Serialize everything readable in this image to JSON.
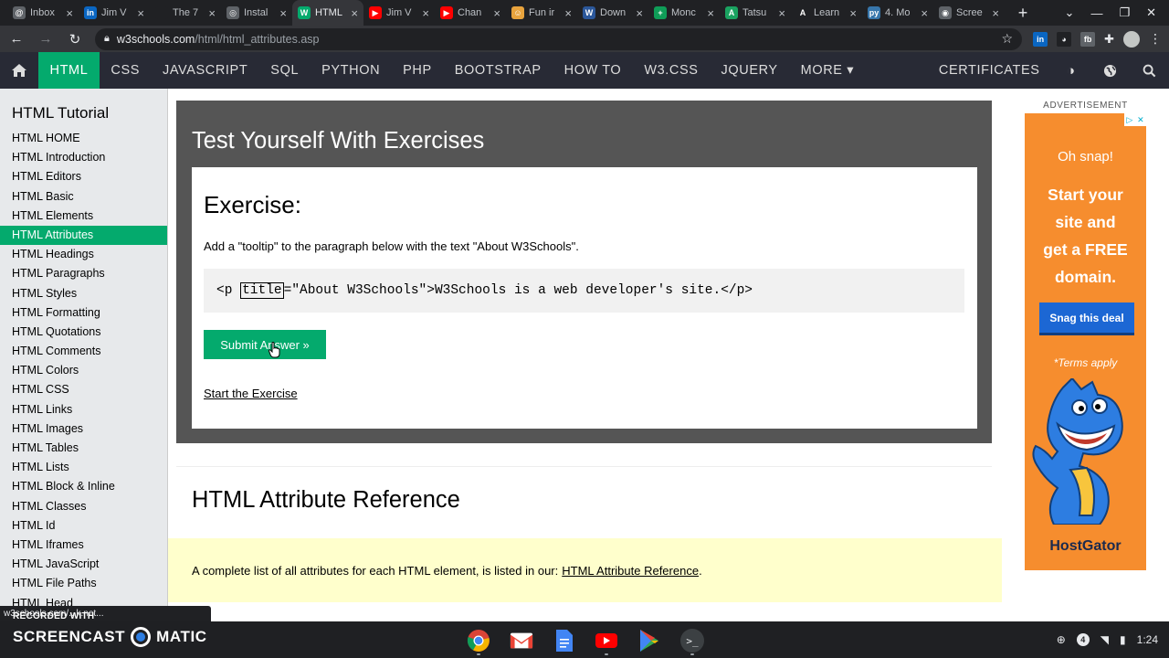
{
  "browser": {
    "tabs": [
      {
        "label": "Inbox",
        "fav_color": "#5f6368",
        "fav_text": "@",
        "active": false
      },
      {
        "label": "Jim V",
        "fav_color": "#0a66c2",
        "fav_text": "in",
        "active": false
      },
      {
        "label": "The 7",
        "fav_color": "#202124",
        "fav_text": "",
        "active": false
      },
      {
        "label": "Instal",
        "fav_color": "#5f6368",
        "fav_text": "◎",
        "active": false
      },
      {
        "label": "HTML",
        "fav_color": "#04AA6D",
        "fav_text": "W",
        "active": true
      },
      {
        "label": "Jim V",
        "fav_color": "#ff0000",
        "fav_text": "▶",
        "active": false
      },
      {
        "label": "Chan",
        "fav_color": "#ff0000",
        "fav_text": "▶",
        "active": false
      },
      {
        "label": "Fun ir",
        "fav_color": "#e8a33d",
        "fav_text": "☺",
        "active": false
      },
      {
        "label": "Down",
        "fav_color": "#2b579a",
        "fav_text": "W",
        "active": false
      },
      {
        "label": "Monc",
        "fav_color": "#0f9d58",
        "fav_text": "+",
        "active": false
      },
      {
        "label": "Tatsu",
        "fav_color": "#1aa260",
        "fav_text": "A",
        "active": false
      },
      {
        "label": "Learn",
        "fav_color": "#202124",
        "fav_text": "A",
        "active": false
      },
      {
        "label": "4. Mo",
        "fav_color": "#3776ab",
        "fav_text": "py",
        "active": false
      },
      {
        "label": "Scree",
        "fav_color": "#5f6368",
        "fav_text": "◉",
        "active": false
      }
    ],
    "url_host": "w3schools.com",
    "url_path": "/html/html_attributes.asp"
  },
  "w3nav": {
    "items": [
      "HTML",
      "CSS",
      "JAVASCRIPT",
      "SQL",
      "PYTHON",
      "PHP",
      "BOOTSTRAP",
      "HOW TO",
      "W3.CSS",
      "JQUERY",
      "MORE ▾"
    ],
    "certificates": "CERTIFICATES"
  },
  "sidebar": {
    "title": "HTML Tutorial",
    "items": [
      "HTML HOME",
      "HTML Introduction",
      "HTML Editors",
      "HTML Basic",
      "HTML Elements",
      "HTML Attributes",
      "HTML Headings",
      "HTML Paragraphs",
      "HTML Styles",
      "HTML Formatting",
      "HTML Quotations",
      "HTML Comments",
      "HTML Colors",
      "HTML CSS",
      "HTML Links",
      "HTML Images",
      "HTML Tables",
      "HTML Lists",
      "HTML Block & Inline",
      "HTML Classes",
      "HTML Id",
      "HTML Iframes",
      "HTML JavaScript",
      "HTML File Paths",
      "HTML Head"
    ],
    "active_index": 5
  },
  "exercise": {
    "heading": "Test Yourself With Exercises",
    "title": "Exercise:",
    "instruction": "Add a \"tooltip\" to the paragraph below with the text \"About W3Schools\".",
    "code_before": "<p ",
    "code_blank": "title",
    "code_after": "=\"About W3Schools\">W3Schools is a web developer's site.</p>",
    "submit_label": "Submit Answer »",
    "start_label": "Start the Exercise"
  },
  "reference": {
    "heading": "HTML Attribute Reference",
    "note_text": "A complete list of all attributes for each HTML element, is listed in our:",
    "note_link": "HTML Attribute Reference",
    "note_end": "."
  },
  "ad": {
    "label": "ADVERTISEMENT",
    "oh_snap": "Oh snap!",
    "lines": [
      "Start your",
      "site and",
      "get a FREE",
      "domain."
    ],
    "button": "Snag this deal",
    "terms": "*Terms apply",
    "brand": "HostGator"
  },
  "overlay": {
    "status_url": "w3schools.com/...k.net...",
    "recorded_with": "RECORDED WITH",
    "brand_left": "SCREENCAST",
    "brand_right": "MATIC"
  },
  "taskbar": {
    "time": "1:24",
    "notification_count": "4"
  },
  "colors": {
    "w3_green": "#04AA6D",
    "w3_dark": "#282A35",
    "sidebar_bg": "#E7E9EB",
    "note_yellow": "#ffffcc",
    "ad_orange": "#f68d2e"
  }
}
